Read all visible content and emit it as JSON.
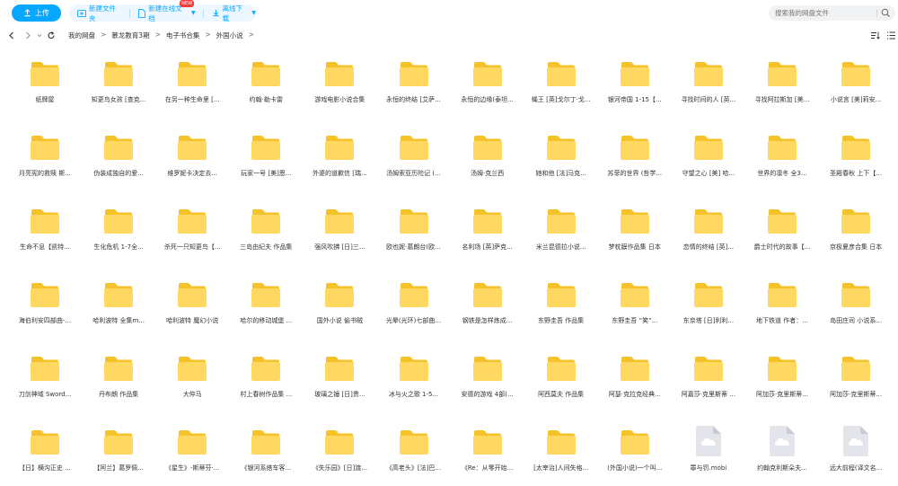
{
  "toolbar": {
    "upload_label": "上传",
    "new_folder_label": "新建文件夹",
    "new_online_doc_label": "新建在线文档",
    "new_badge": "NEW",
    "offline_download_label": "离线下载",
    "accent_color": "#06a7ff"
  },
  "search": {
    "placeholder": "搜索我的网盘文件"
  },
  "breadcrumb": [
    "我的网盘",
    "慕龙教育3期",
    "电子书合集",
    "外国小说"
  ],
  "items": [
    {
      "type": "folder",
      "name": "纸牌屋"
    },
    {
      "type": "folder",
      "name": "知更鸟女孩 [查克..."
    },
    {
      "type": "folder",
      "name": "在另一种生命里 [..."
    },
    {
      "type": "folder",
      "name": "约翰·勒卡雷"
    },
    {
      "type": "folder",
      "name": "游戏电影小说合集"
    },
    {
      "type": "folder",
      "name": "永恒的终结 [艾萨..."
    },
    {
      "type": "folder",
      "name": "永恒的边缘(泰坦..."
    },
    {
      "type": "folder",
      "name": "蝇王 [英]戈尔丁·戈..."
    },
    {
      "type": "folder",
      "name": "银河帝国 1-15【..."
    },
    {
      "type": "folder",
      "name": "寻找时间的人 [英..."
    },
    {
      "type": "folder",
      "name": "寻找阿拉斯加 [美..."
    },
    {
      "type": "folder",
      "name": "小说言 [美]莉安..."
    },
    {
      "type": "folder",
      "name": "月亮宪的救赎 斯..."
    },
    {
      "type": "folder",
      "name": "伪装成独自的爱..."
    },
    {
      "type": "folder",
      "name": "维罗妮卡决定去..."
    },
    {
      "type": "folder",
      "name": "玩家一号 [美]恩..."
    },
    {
      "type": "folder",
      "name": "外婆的道歉信 [瑞..."
    },
    {
      "type": "folder",
      "name": "汤姆索亚历险记 (..."
    },
    {
      "type": "folder",
      "name": "汤姆·克兰西"
    },
    {
      "type": "folder",
      "name": "她和他 [法]马克..."
    },
    {
      "type": "folder",
      "name": "苏菲的世界 (哲学..."
    },
    {
      "type": "folder",
      "name": "守望之心 [美] 哈..."
    },
    {
      "type": "folder",
      "name": "世界的凛冬 全3..."
    },
    {
      "type": "folder",
      "name": "圣殿春秋 上下【..."
    },
    {
      "type": "folder",
      "name": "生命不息【凯特..."
    },
    {
      "type": "folder",
      "name": "生化危机 1-7全..."
    },
    {
      "type": "folder",
      "name": "杀死一只知更鸟【..."
    },
    {
      "type": "folder",
      "name": "三岛由纪夫 作品集"
    },
    {
      "type": "folder",
      "name": "强风吹拂 [日]三..."
    },
    {
      "type": "folder",
      "name": "欧也妮·葛朗台(欧..."
    },
    {
      "type": "folder",
      "name": "名利场 [英]萨克..."
    },
    {
      "type": "folder",
      "name": "米兰昆德拉小说..."
    },
    {
      "type": "folder",
      "name": "梦枕貘作品集 日本"
    },
    {
      "type": "folder",
      "name": "恋情的终结 [英]..."
    },
    {
      "type": "folder",
      "name": "爵士时代的故事【..."
    },
    {
      "type": "folder",
      "name": "京极夏彦合集 日本"
    },
    {
      "type": "folder",
      "name": "海伯利安四部曲-..."
    },
    {
      "type": "folder",
      "name": "哈利波特 全集m..."
    },
    {
      "type": "folder",
      "name": "哈利波特 魔幻小说"
    },
    {
      "type": "folder",
      "name": "哈尔的移动城堡 ..."
    },
    {
      "type": "folder",
      "name": "国外小说 偷书贼"
    },
    {
      "type": "folder",
      "name": "光晕(光环)七部曲..."
    },
    {
      "type": "folder",
      "name": "钢铁是怎样炼成..."
    },
    {
      "type": "folder",
      "name": "东野圭吾 作品集"
    },
    {
      "type": "folder",
      "name": "东野圭吾 “笑”..."
    },
    {
      "type": "folder",
      "name": "东京塔 [日]利利..."
    },
    {
      "type": "folder",
      "name": "地下铁道 作者：..."
    },
    {
      "type": "folder",
      "name": "岛田庄司 小说系..."
    },
    {
      "type": "folder",
      "name": "刀剑神域 Sword..."
    },
    {
      "type": "folder",
      "name": "丹布朗 作品集"
    },
    {
      "type": "folder",
      "name": "大仲马"
    },
    {
      "type": "folder",
      "name": "村上春树作品集 ..."
    },
    {
      "type": "folder",
      "name": "玻璃之锤 [日]贵..."
    },
    {
      "type": "folder",
      "name": "冰与火之歌 1-5..."
    },
    {
      "type": "folder",
      "name": "安德的游戏 4部(..."
    },
    {
      "type": "folder",
      "name": "阿西莫夫 作品集"
    },
    {
      "type": "folder",
      "name": "阿瑟·克拉克经典..."
    },
    {
      "type": "folder",
      "name": "阿嘉莎·克里斯蒂 ..."
    },
    {
      "type": "folder",
      "name": "阿加莎·克里斯蒂..."
    },
    {
      "type": "folder",
      "name": "阿加莎·克里斯蒂..."
    },
    {
      "type": "folder",
      "name": "【日】横沟正史 ..."
    },
    {
      "type": "folder",
      "name": "【阿兰】葛罗佩..."
    },
    {
      "type": "folder",
      "name": "《星生》-斯蒂芬·..."
    },
    {
      "type": "folder",
      "name": "《银河系搭车客..."
    },
    {
      "type": "folder",
      "name": "《失乐园》[日]渡..."
    },
    {
      "type": "folder",
      "name": "《高老头》[法]巴..."
    },
    {
      "type": "folder",
      "name": "《Re：从零开始..."
    },
    {
      "type": "folder",
      "name": "[太宰治]人间失格..."
    },
    {
      "type": "folder",
      "name": "(外国小说)一个叫..."
    },
    {
      "type": "file",
      "name": "罪与罚.mobi"
    },
    {
      "type": "file",
      "name": "约翰克利斯朵夫..."
    },
    {
      "type": "file",
      "name": "远大前程(译文名..."
    }
  ]
}
